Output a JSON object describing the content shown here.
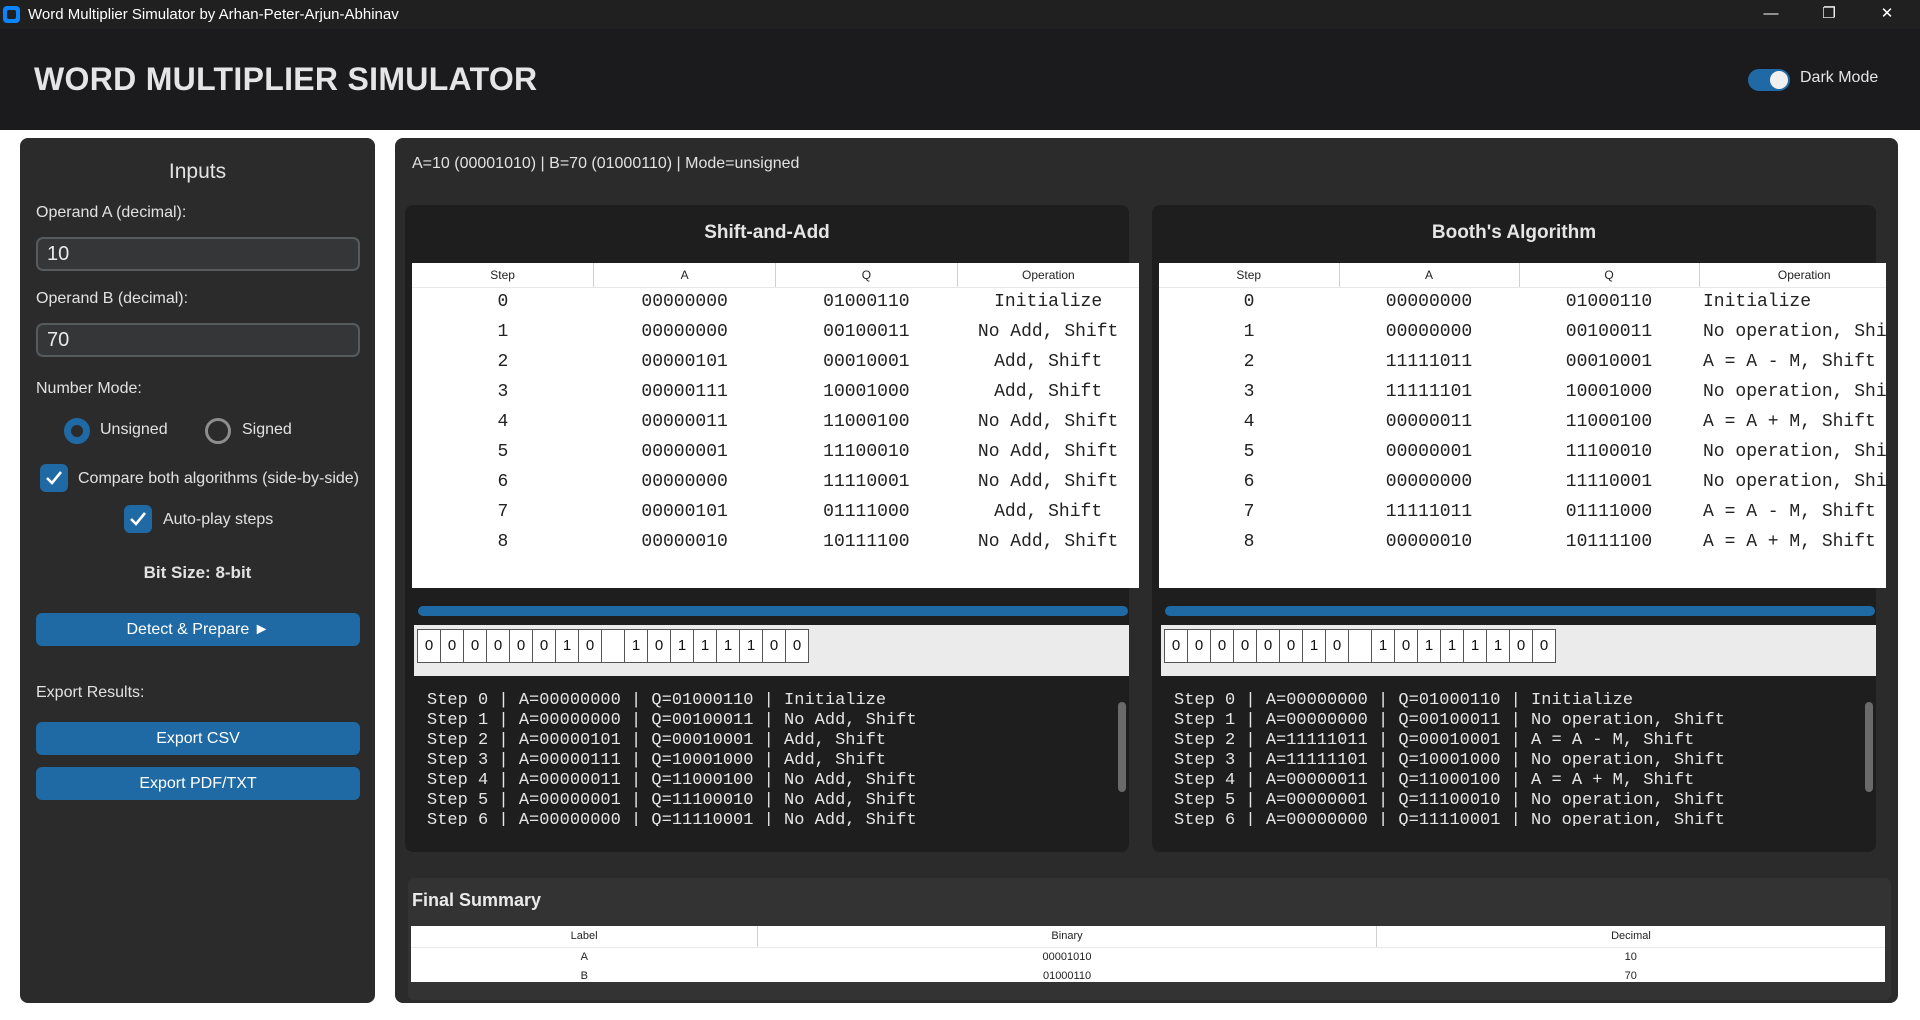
{
  "window": {
    "title": "Word Multiplier Simulator by Arhan-Peter-Arjun-Abhinav"
  },
  "header": {
    "title": "WORD MULTIPLIER SIMULATOR",
    "dark_mode_label": "Dark Mode",
    "dark_mode_on": true
  },
  "sidebar": {
    "heading": "Inputs",
    "operand_a_label": "Operand A (decimal):",
    "operand_a_value": "10",
    "operand_b_label": "Operand B (decimal):",
    "operand_b_value": "70",
    "number_mode_label": "Number Mode:",
    "mode_unsigned": "Unsigned",
    "mode_signed": "Signed",
    "selected_mode": "Unsigned",
    "compare_label": "Compare both algorithms (side-by-side)",
    "compare_checked": true,
    "autoplay_label": "Auto-play steps",
    "autoplay_checked": true,
    "bit_size": "Bit Size: 8-bit",
    "detect_button": "Detect & Prepare ►",
    "export_label": "Export Results:",
    "export_csv": "Export CSV",
    "export_pdf": "Export PDF/TXT"
  },
  "status_line": "A=10 (00001010)  |  B=70 (01000110)  | Mode=unsigned",
  "columns": [
    "Step",
    "A",
    "Q",
    "Operation"
  ],
  "shift_add": {
    "title": "Shift-and-Add",
    "rows": [
      [
        "0",
        "00000000",
        "01000110",
        "Initialize"
      ],
      [
        "1",
        "00000000",
        "00100011",
        "No Add, Shift"
      ],
      [
        "2",
        "00000101",
        "00010001",
        "Add, Shift"
      ],
      [
        "3",
        "00000111",
        "10001000",
        "Add, Shift"
      ],
      [
        "4",
        "00000011",
        "11000100",
        "No Add, Shift"
      ],
      [
        "5",
        "00000001",
        "11100010",
        "No Add, Shift"
      ],
      [
        "6",
        "00000000",
        "11110001",
        "No Add, Shift"
      ],
      [
        "7",
        "00000101",
        "01111000",
        "Add, Shift"
      ],
      [
        "8",
        "00000010",
        "10111100",
        "No Add, Shift"
      ]
    ],
    "progress": 1.0,
    "bits_a": [
      "0",
      "0",
      "0",
      "0",
      "0",
      "0",
      "1",
      "0"
    ],
    "bits_q": [
      "1",
      "0",
      "1",
      "1",
      "1",
      "1",
      "0",
      "0"
    ],
    "log": [
      "Step 0 | A=00000000 | Q=01000110 | Initialize",
      "Step 1 | A=00000000 | Q=00100011 | No Add, Shift",
      "Step 2 | A=00000101 | Q=00010001 | Add, Shift",
      "Step 3 | A=00000111 | Q=10001000 | Add, Shift",
      "Step 4 | A=00000011 | Q=11000100 | No Add, Shift",
      "Step 5 | A=00000001 | Q=11100010 | No Add, Shift",
      "Step 6 | A=00000000 | Q=11110001 | No Add, Shift"
    ]
  },
  "booth": {
    "title": "Booth's Algorithm",
    "rows": [
      [
        "0",
        "00000000",
        "01000110",
        "Initialize"
      ],
      [
        "1",
        "00000000",
        "00100011",
        "No operation, Shift"
      ],
      [
        "2",
        "11111011",
        "00010001",
        "A = A - M, Shift"
      ],
      [
        "3",
        "11111101",
        "10001000",
        "No operation, Shift"
      ],
      [
        "4",
        "00000011",
        "11000100",
        "A = A + M, Shift"
      ],
      [
        "5",
        "00000001",
        "11100010",
        "No operation, Shift"
      ],
      [
        "6",
        "00000000",
        "11110001",
        "No operation, Shift"
      ],
      [
        "7",
        "11111011",
        "01111000",
        "A = A - M, Shift"
      ],
      [
        "8",
        "00000010",
        "10111100",
        "A = A + M, Shift"
      ]
    ],
    "progress": 1.0,
    "bits_a": [
      "0",
      "0",
      "0",
      "0",
      "0",
      "0",
      "1",
      "0"
    ],
    "bits_q": [
      "1",
      "0",
      "1",
      "1",
      "1",
      "1",
      "0",
      "0"
    ],
    "log": [
      "Step 0 | A=00000000 | Q=01000110 | Initialize",
      "Step 1 | A=00000000 | Q=00100011 | No operation, Shift",
      "Step 2 | A=11111011 | Q=00010001 | A = A - M, Shift",
      "Step 3 | A=11111101 | Q=10001000 | No operation, Shift",
      "Step 4 | A=00000011 | Q=11000100 | A = A + M, Shift",
      "Step 5 | A=00000001 | Q=11100010 | No operation, Shift",
      "Step 6 | A=00000000 | Q=11110001 | No operation, Shift"
    ]
  },
  "summary": {
    "title": "Final Summary",
    "columns": [
      "Label",
      "Binary",
      "Decimal"
    ],
    "rows": [
      [
        "A",
        "00001010",
        "10"
      ],
      [
        "B",
        "01000110",
        "70"
      ]
    ]
  },
  "colors": {
    "accent": "#1f6aa5",
    "panel": "#2b2b2b",
    "background": "#1b1b1d"
  }
}
